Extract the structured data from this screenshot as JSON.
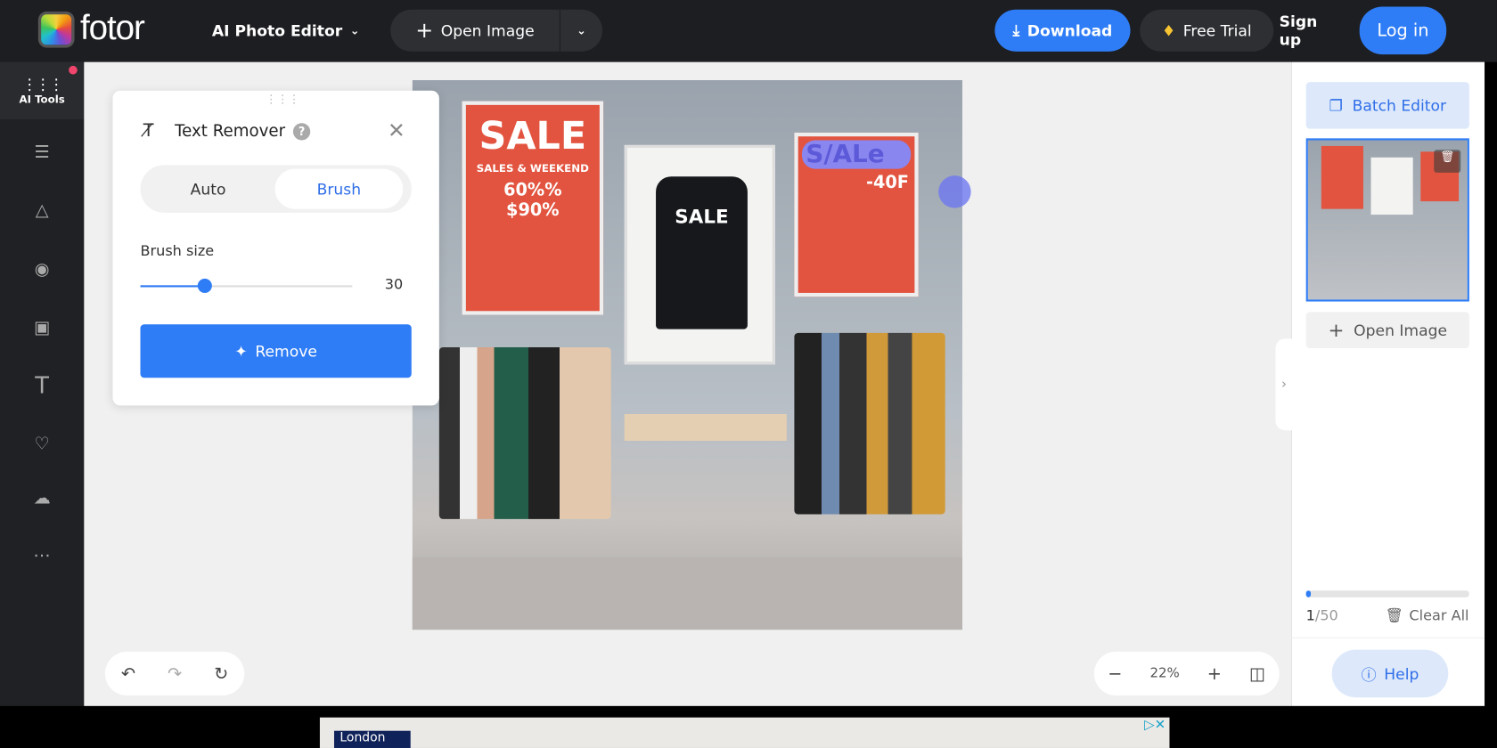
{
  "header": {
    "brand": "fotor",
    "editor_menu": "AI Photo Editor",
    "open_image": "Open Image",
    "download": "Download",
    "free_trial": "Free Trial",
    "sign_up": "Sign up",
    "log_in": "Log in"
  },
  "sidebar": {
    "items": [
      {
        "label": "AI Tools",
        "icon": "grid-dots-icon"
      },
      {
        "icon": "sliders-icon"
      },
      {
        "icon": "flask-icon"
      },
      {
        "icon": "eye-icon"
      },
      {
        "icon": "frame-icon"
      },
      {
        "icon": "text-icon"
      },
      {
        "icon": "shapes-icon"
      },
      {
        "icon": "cloud-upload-icon"
      },
      {
        "icon": "more-icon"
      }
    ]
  },
  "tool_panel": {
    "title": "Text Remover",
    "modes": [
      "Auto",
      "Brush"
    ],
    "active_mode": "Brush",
    "brush_size_label": "Brush size",
    "brush_size": 30,
    "brush_size_max": 100,
    "remove": "Remove"
  },
  "image": {
    "poster_left": {
      "title": "SALE",
      "line1": "SALES & WEEKEND",
      "line2": "60%%",
      "line3": "$90%"
    },
    "shirt_text": "SALE",
    "poster_right": {
      "title": "S/ALe",
      "line1": "-40F"
    }
  },
  "zoom": {
    "value": "22%"
  },
  "right_panel": {
    "batch_editor": "Batch Editor",
    "open_image": "Open Image",
    "count_current": "1",
    "count_total": "/50",
    "progress": 0.02,
    "clear_all": "Clear All",
    "help": "Help"
  },
  "ad": {
    "text": "London"
  },
  "colors": {
    "accent": "#2f7df6",
    "topbar": "#1d1e21",
    "sidebar": "#202124"
  }
}
